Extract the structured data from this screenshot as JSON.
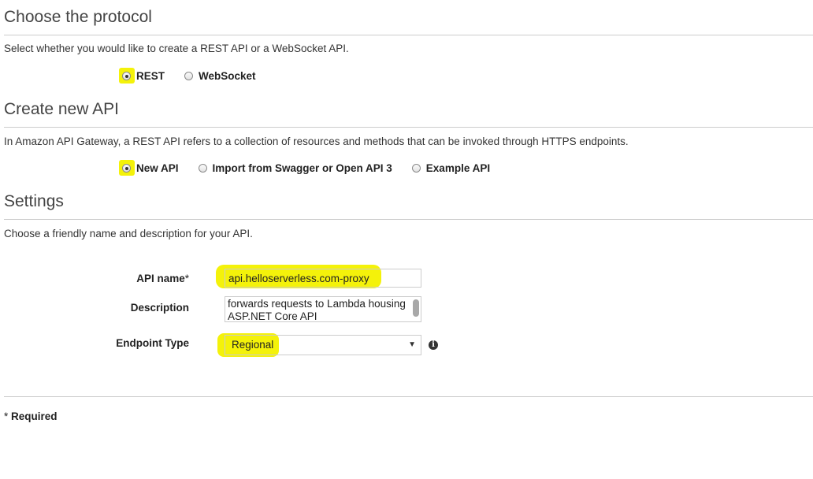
{
  "protocol": {
    "heading": "Choose the protocol",
    "description": "Select whether you would like to create a REST API or a WebSocket API.",
    "options": [
      {
        "label": "REST",
        "checked": true
      },
      {
        "label": "WebSocket",
        "checked": false
      }
    ]
  },
  "create_api": {
    "heading": "Create new API",
    "description": "In Amazon API Gateway, a REST API refers to a collection of resources and methods that can be invoked through HTTPS endpoints.",
    "options": [
      {
        "label": "New API",
        "checked": true
      },
      {
        "label": "Import from Swagger or Open API 3",
        "checked": false
      },
      {
        "label": "Example API",
        "checked": false
      }
    ]
  },
  "settings": {
    "heading": "Settings",
    "description": "Choose a friendly name and description for your API.",
    "api_name_label": "API name",
    "api_name_required_mark": "*",
    "api_name_value": "api.helloserverless.com-proxy",
    "description_label": "Description",
    "description_value": "forwards requests to Lambda housing ASP.NET Core API",
    "endpoint_type_label": "Endpoint Type",
    "endpoint_type_value": "Regional",
    "info_icon": "info-icon"
  },
  "footer": {
    "required_mark": "*",
    "required_label": "Required"
  },
  "colors": {
    "highlight": "#f4f20a",
    "rule": "#cccccc"
  }
}
